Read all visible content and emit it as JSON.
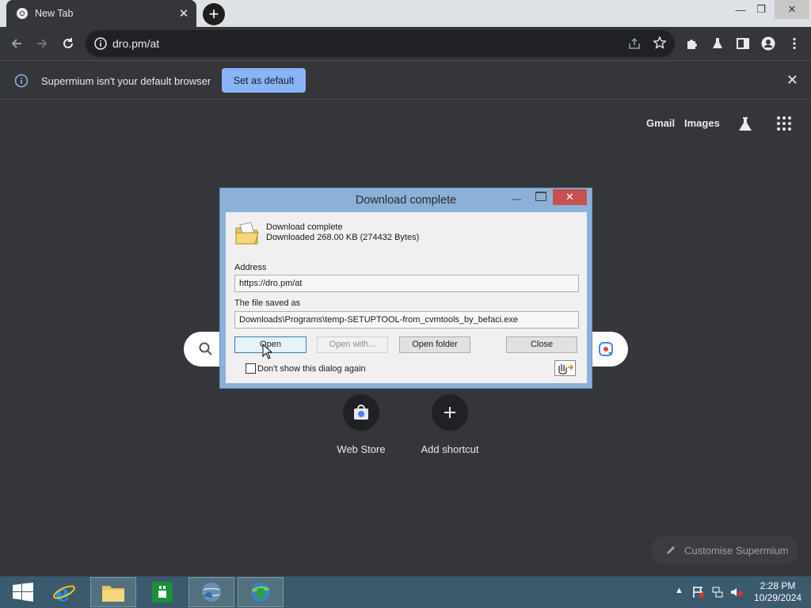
{
  "browser": {
    "tab_title": "New Tab",
    "new_tab_symbol": "+",
    "url": "dro.pm/at",
    "infobar": {
      "message": "Supermium isn't your default browser",
      "button": "Set as default",
      "close": "✕"
    }
  },
  "ntp": {
    "gmail": "Gmail",
    "images": "Images",
    "shortcuts": [
      {
        "label": "Web Store",
        "icon": "web-store-icon"
      },
      {
        "label": "Add shortcut",
        "icon": "plus-icon"
      }
    ],
    "customise": "Customise Supermium"
  },
  "dialog": {
    "title": "Download complete",
    "close_symbol": "✕",
    "status_line1": "Download complete",
    "status_line2": "Downloaded 268.00  KB (274432 Bytes)",
    "address_label": "Address",
    "address_value": "https://dro.pm/at",
    "saved_label": "The file saved as",
    "saved_value": "Downloads\\Programs\\temp-SETUPTOOL-from_cvmtools_by_befaci.exe",
    "buttons": {
      "open": "Open",
      "open_with": "Open with...",
      "open_folder": "Open folder",
      "close": "Close"
    },
    "checkbox_label": "Don't show this dialog again",
    "checkbox_checked": false
  },
  "taskbar": {
    "time": "2:28 PM",
    "date": "10/29/2024",
    "items": [
      "start-icon",
      "internet-explorer-icon",
      "file-explorer-icon",
      "store-icon",
      "globe-app-icon",
      "download-manager-icon"
    ]
  },
  "colors": {
    "chrome_dark": "#35363a",
    "accent_blue": "#8ab4f8",
    "taskbar": "#3b5a6e",
    "dialog_frame": "#8cb1d9",
    "dialog_close": "#c75050"
  }
}
